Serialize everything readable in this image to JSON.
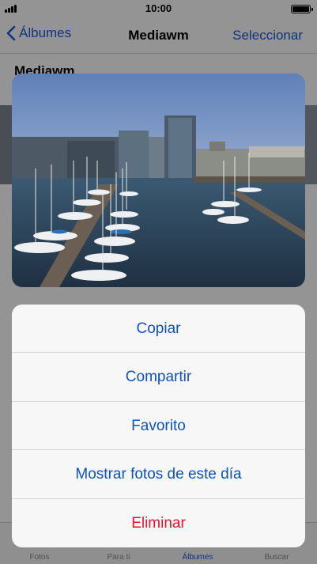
{
  "status_bar": {
    "time": "10:00"
  },
  "nav": {
    "back_label": "Álbumes",
    "title": "Mediawm",
    "select_label": "Seleccionar"
  },
  "album": {
    "title": "Mediawm"
  },
  "tabs": [
    {
      "label": "Fotos"
    },
    {
      "label": "Para ti"
    },
    {
      "label": "Álbumes"
    },
    {
      "label": "Buscar"
    }
  ],
  "preview": {
    "icon": "harbor-photo"
  },
  "actions": [
    {
      "label": "Copiar"
    },
    {
      "label": "Compartir"
    },
    {
      "label": "Favorito"
    },
    {
      "label": "Mostrar fotos de este día"
    },
    {
      "label": "Eliminar"
    }
  ],
  "colors": {
    "accent": "#1a5ad8",
    "action_text": "#0f52b8",
    "destructive": "#e6142d",
    "sheet_bg": "#f7f7f7"
  }
}
